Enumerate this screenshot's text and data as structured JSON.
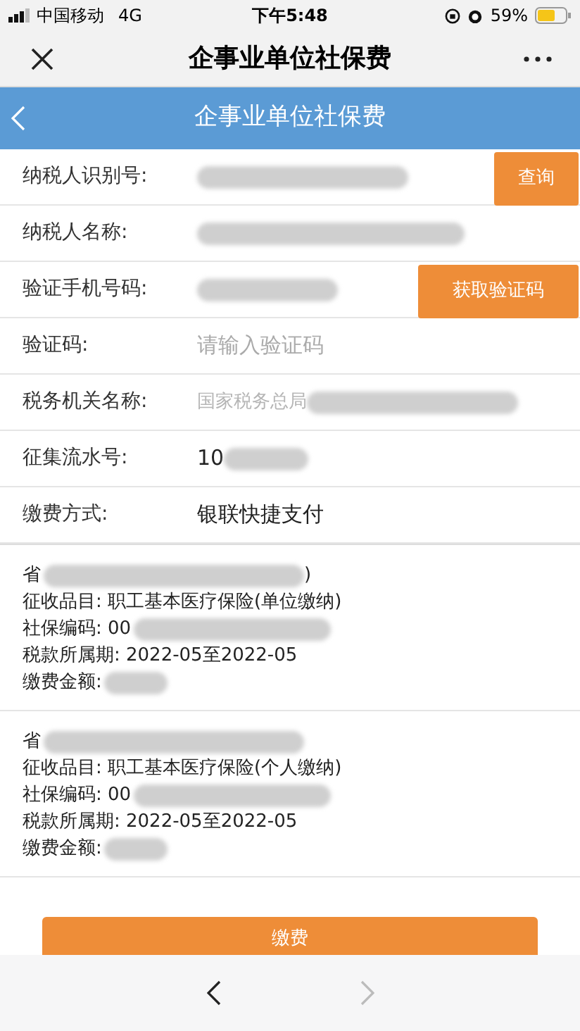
{
  "status_bar": {
    "carrier": "中国移动",
    "network": "4G",
    "time": "下午5:48",
    "battery": "59%"
  },
  "window": {
    "title": "企事业单位社保费"
  },
  "header": {
    "title": "企事业单位社保费"
  },
  "form_rows": [
    {
      "label": "纳税人识别号:",
      "redacted": true,
      "button": "查询"
    },
    {
      "label": "纳税人名称:",
      "redacted": true
    },
    {
      "label": "验证手机号码:",
      "redacted": true,
      "button": "获取验证码"
    },
    {
      "label": "验证码:",
      "placeholder": "请输入验证码",
      "redacted": false
    },
    {
      "label": "税务机关名称:",
      "value": "国家税务总局",
      "muted": true,
      "redacted": true
    },
    {
      "label": "征集流水号:",
      "value": "10",
      "redacted": true
    },
    {
      "label": "缴费方式:",
      "value": "银联快捷支付",
      "redacted": false
    }
  ],
  "records": [
    {
      "lines": [
        {
          "text": "省",
          "redacted": true,
          "tail": ")"
        },
        {
          "text": "征收品目: 职工基本医疗保险(单位缴纳)",
          "redacted": false
        },
        {
          "text": "社保编码: 00",
          "redacted": true
        },
        {
          "text": "税款所属期: 2022-05至2022-05",
          "redacted": false
        },
        {
          "text": "缴费金额:",
          "redacted": true
        }
      ]
    },
    {
      "lines": [
        {
          "text": "省",
          "redacted": true
        },
        {
          "text": "征收品目: 职工基本医疗保险(个人缴纳)",
          "redacted": false
        },
        {
          "text": "社保编码: 00",
          "redacted": true
        },
        {
          "text": "税款所属期: 2022-05至2022-05",
          "redacted": false
        },
        {
          "text": "缴费金额:",
          "redacted": true
        }
      ]
    }
  ],
  "pay_button": "缴费",
  "bottom_nav": {
    "back_disabled": false,
    "forward_disabled": true
  }
}
